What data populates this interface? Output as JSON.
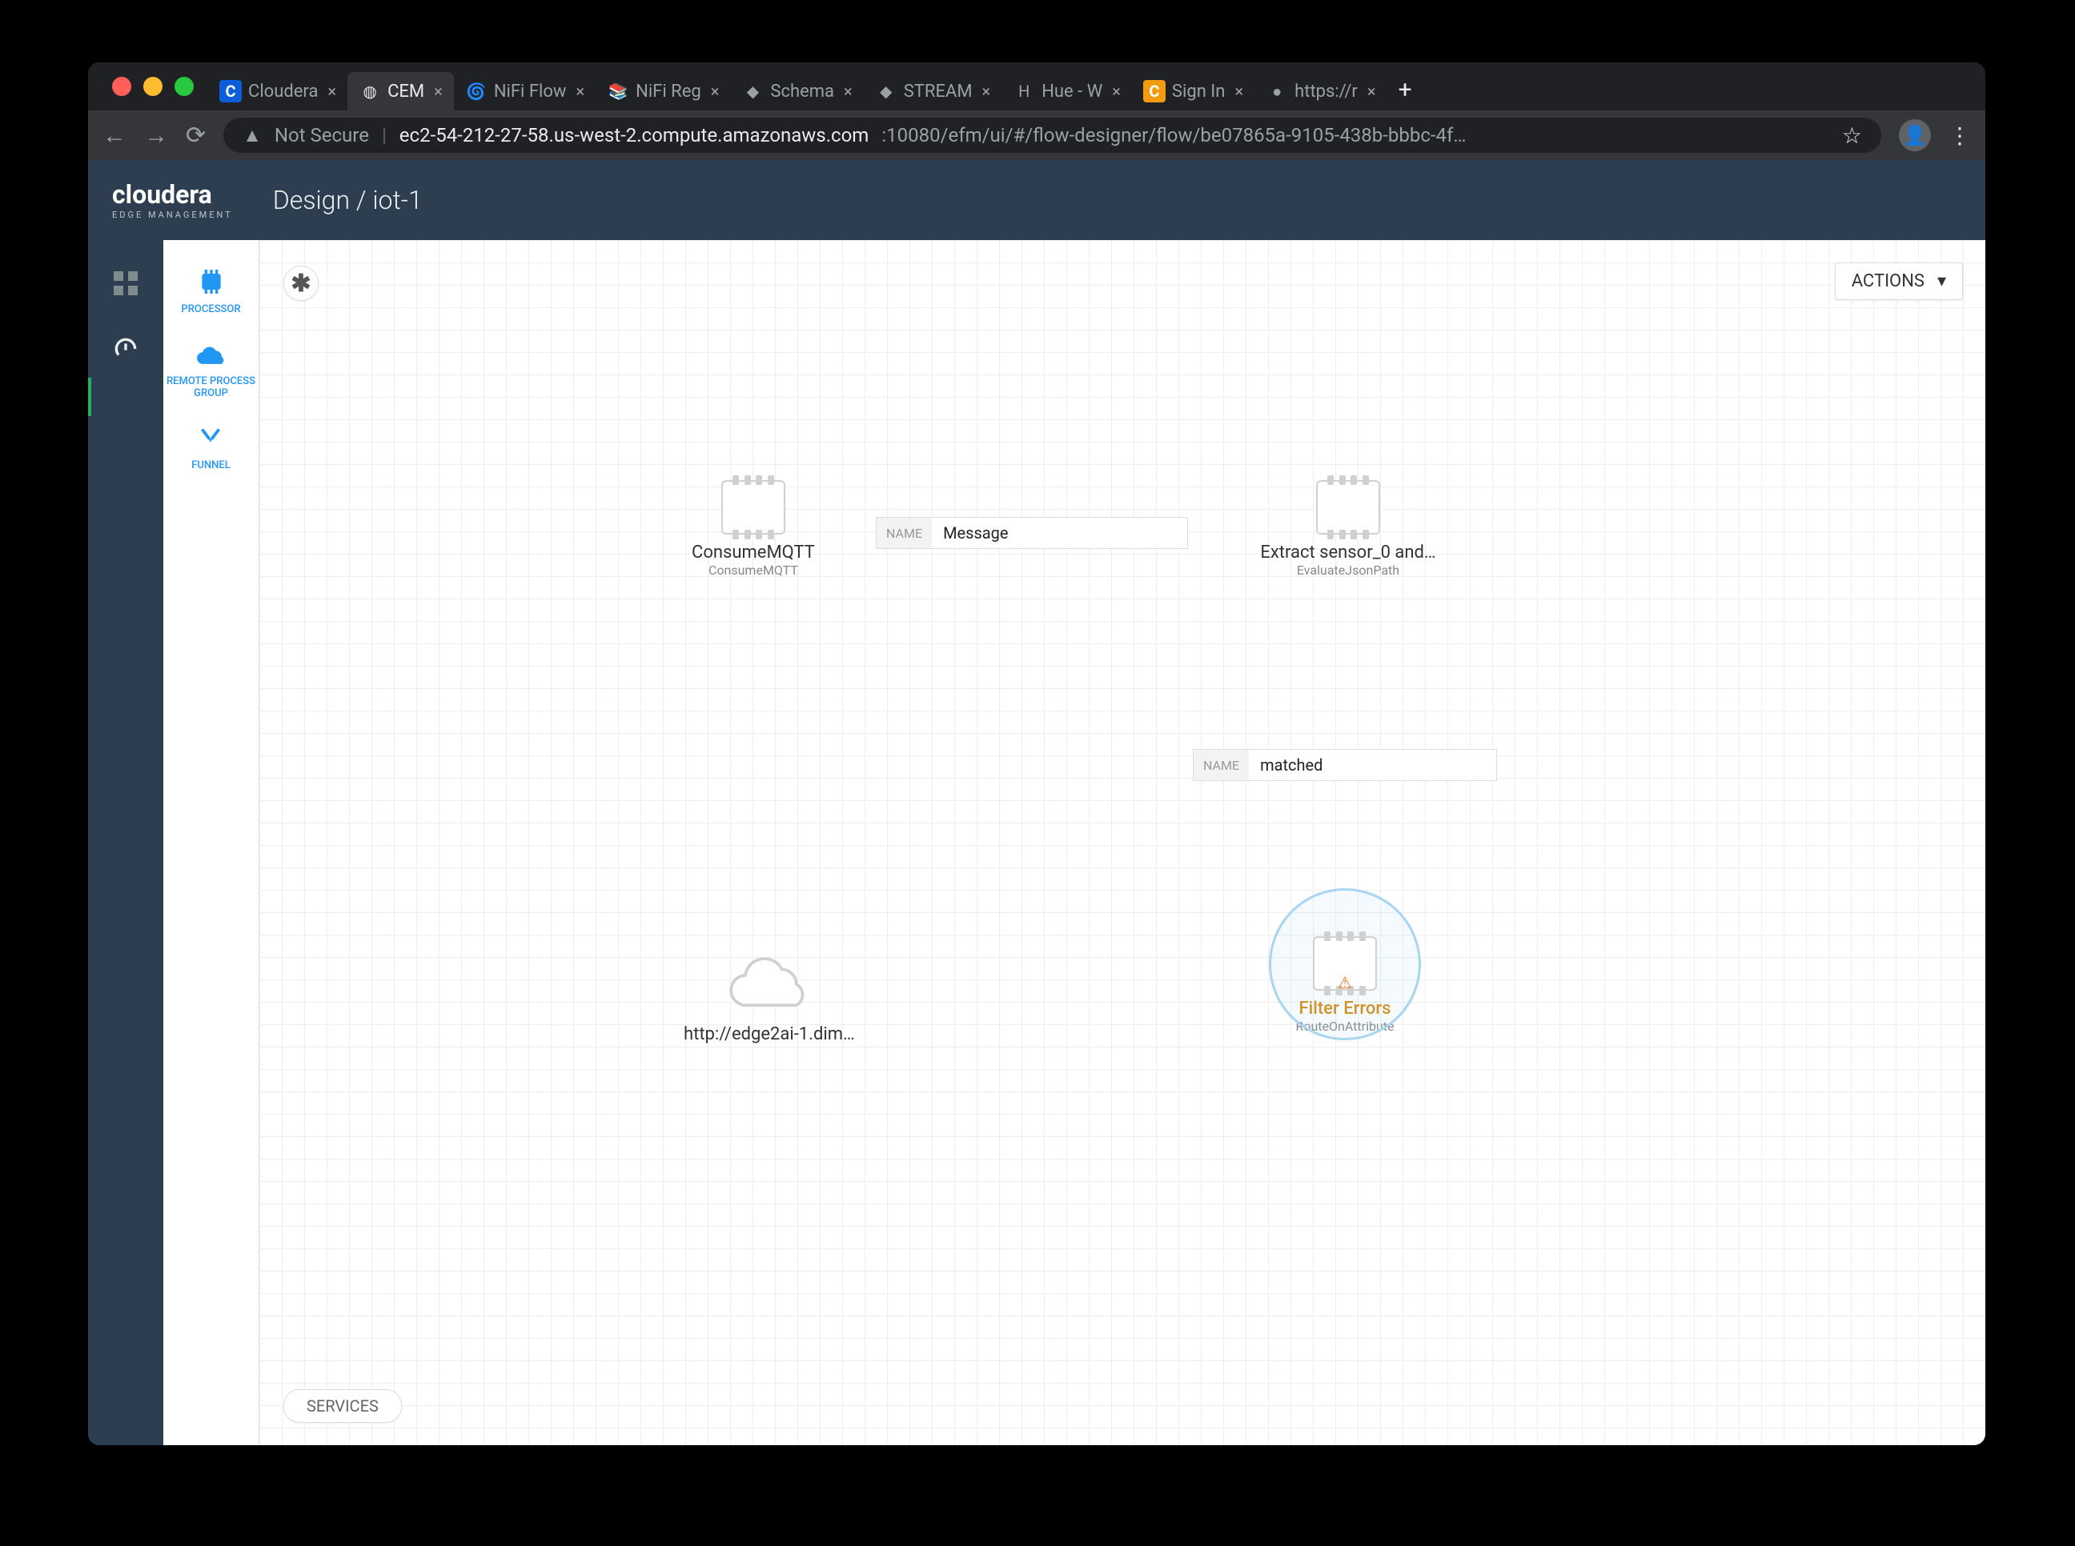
{
  "browser": {
    "tabs": [
      {
        "title": "Cloudera",
        "fav": "C",
        "fav_bg": "#0b5ed7",
        "fav_fg": "#fff"
      },
      {
        "title": "CEM",
        "fav": "◍",
        "fav_bg": "transparent",
        "fav_fg": "#9aa0a6",
        "active": true
      },
      {
        "title": "NiFi Flow",
        "fav": "🌀",
        "fav_bg": "transparent",
        "fav_fg": "#7e8"
      },
      {
        "title": "NiFi Reg",
        "fav": "📚",
        "fav_bg": "transparent",
        "fav_fg": "#8c8"
      },
      {
        "title": "Schema",
        "fav": "◆",
        "fav_bg": "transparent",
        "fav_fg": "#2c8"
      },
      {
        "title": "STREAM",
        "fav": "◆",
        "fav_bg": "transparent",
        "fav_fg": "#2c8"
      },
      {
        "title": "Hue - W",
        "fav": "H",
        "fav_bg": "transparent",
        "fav_fg": "#4a90e2"
      },
      {
        "title": "Sign In",
        "fav": "C",
        "fav_bg": "#f39c12",
        "fav_fg": "#fff"
      },
      {
        "title": "https://r",
        "fav": "●",
        "fav_bg": "transparent",
        "fav_fg": "#e8eaed"
      }
    ],
    "not_secure": "Not Secure",
    "url_host": "ec2-54-212-27-58.us-west-2.compute.amazonaws.com",
    "url_path": ":10080/efm/ui/#/flow-designer/flow/be07865a-9105-438b-bbbc-4f…"
  },
  "header": {
    "logo_main": "cloudera",
    "logo_sub": "EDGE MANAGEMENT",
    "breadcrumb": "Design / iot-1"
  },
  "sidebar": {
    "grid": "⊞",
    "dash": "📈"
  },
  "palette": {
    "processor": "PROCESSOR",
    "rpg": "REMOTE PROCESS GROUP",
    "funnel": "FUNNEL"
  },
  "canvas": {
    "actions_label": "ACTIONS",
    "services_label": "SERVICES",
    "badge": "✱",
    "nodes": {
      "consume": {
        "title": "ConsumeMQTT",
        "sub": "ConsumeMQTT"
      },
      "extract": {
        "title": "Extract sensor_0 and…",
        "sub": "EvaluateJsonPath"
      },
      "filter": {
        "title": "Filter Errors",
        "sub": "RouteOnAttribute"
      },
      "cloud": {
        "title": "http://edge2ai-1.dim…"
      }
    },
    "connections": {
      "name_label": "NAME",
      "c1": "Message",
      "c2": "matched"
    }
  }
}
